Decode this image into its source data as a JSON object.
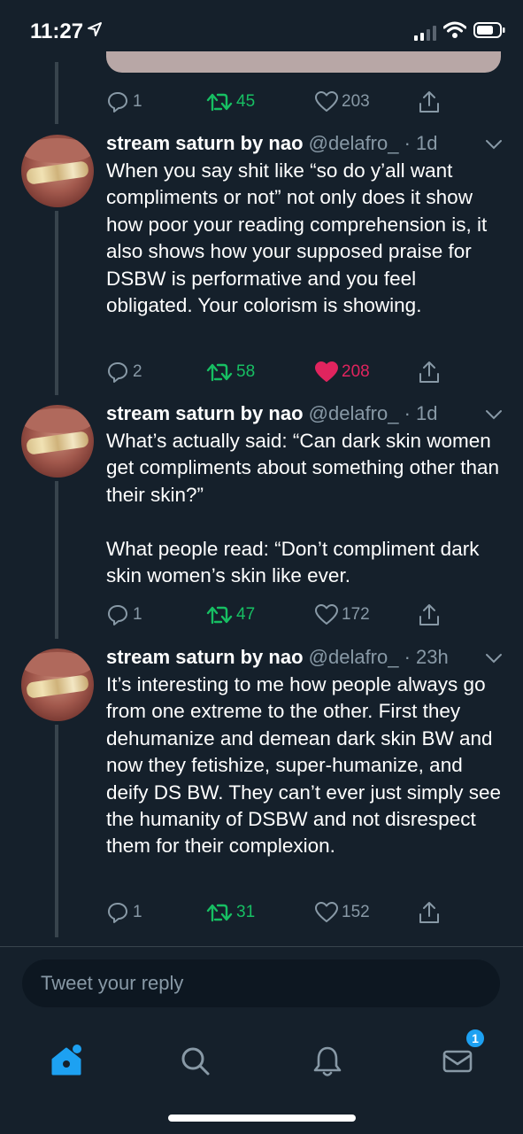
{
  "status_bar": {
    "time": "11:27",
    "location_icon": "location-arrow-icon",
    "signal_icon": "cellular-signal-icon",
    "wifi_icon": "wifi-icon",
    "battery_icon": "battery-icon"
  },
  "colors": {
    "background": "#15202b",
    "secondary_text": "#8899a6",
    "retweet_green": "#17bf63",
    "like_red": "#e0245e",
    "accent_blue": "#1da1f2",
    "thread_line": "#38444d"
  },
  "previous_tweet_actions": {
    "replies": "1",
    "retweets": "45",
    "likes": "203"
  },
  "tweets": [
    {
      "name": "stream saturn by nao",
      "handle": "@delafro_",
      "time": "· 1d",
      "text": "When you say shit like “so do y’all want compliments or not” not only does it show how poor your reading comprehension is, it also shows how your supposed praise for DSBW is performative and you feel obligated. Your colorism is showing.",
      "replies": "2",
      "retweets": "58",
      "likes": "208",
      "liked": true
    },
    {
      "name": "stream saturn by nao",
      "handle": "@delafro_",
      "time": "· 1d",
      "text": "What’s actually said: “Can dark skin women get compliments about something other than their skin?”\n\nWhat people read: “Don’t compliment dark skin women’s skin like ever.",
      "replies": "1",
      "retweets": "47",
      "likes": "172",
      "liked": false
    },
    {
      "name": "stream saturn by nao",
      "handle": "@delafro_",
      "time": "· 23h",
      "text": "It’s interesting to me how people always go from one extreme to the other. First they dehumanize and demean dark skin BW and now they fetishize, super-humanize, and deify DS BW. They can’t ever just simply see the humanity of DSBW and not disrespect them for their complexion.",
      "replies": "1",
      "retweets": "31",
      "likes": "152",
      "liked": false
    }
  ],
  "reply": {
    "placeholder": "Tweet your reply"
  },
  "tab_bar": {
    "items": [
      "home-icon",
      "search-icon",
      "notifications-bell-icon",
      "messages-envelope-icon"
    ],
    "messages_badge": "1"
  }
}
